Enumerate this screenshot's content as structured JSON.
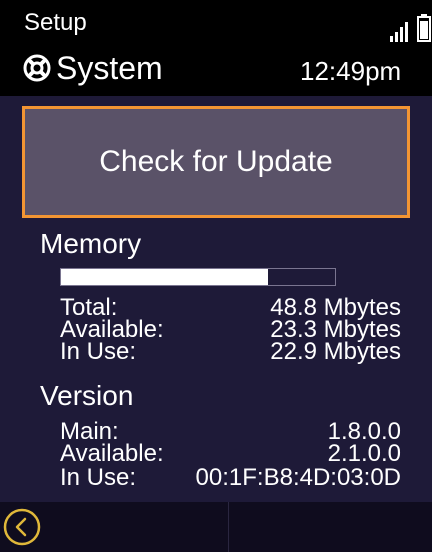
{
  "status_bar": {
    "title": "Setup",
    "signal_icon": "signal-strength-icon",
    "battery_icon": "battery-icon"
  },
  "header": {
    "app_icon": "lifebuoy-icon",
    "title": "System",
    "time": "12:49pm"
  },
  "update_button": {
    "label": "Check for Update",
    "accent_color": "#f29533"
  },
  "memory": {
    "heading": "Memory",
    "usage_fraction": 0.755,
    "rows": [
      {
        "label": "Total:",
        "value": "48.8 Mbytes"
      },
      {
        "label": "Available:",
        "value": "23.3 Mbytes"
      },
      {
        "label": "In Use:",
        "value": "22.9 Mbytes"
      }
    ]
  },
  "version": {
    "heading": "Version",
    "rows": [
      {
        "label": "Main:",
        "value": "1.8.0.0"
      },
      {
        "label": "Available:",
        "value": "2.1.0.0"
      },
      {
        "label": "In Use:",
        "value": "00:1F:B8:4D:03:0D"
      }
    ]
  },
  "bottom_bar": {
    "back_icon": "back-arrow-icon",
    "accent_color": "#e0b83a"
  }
}
